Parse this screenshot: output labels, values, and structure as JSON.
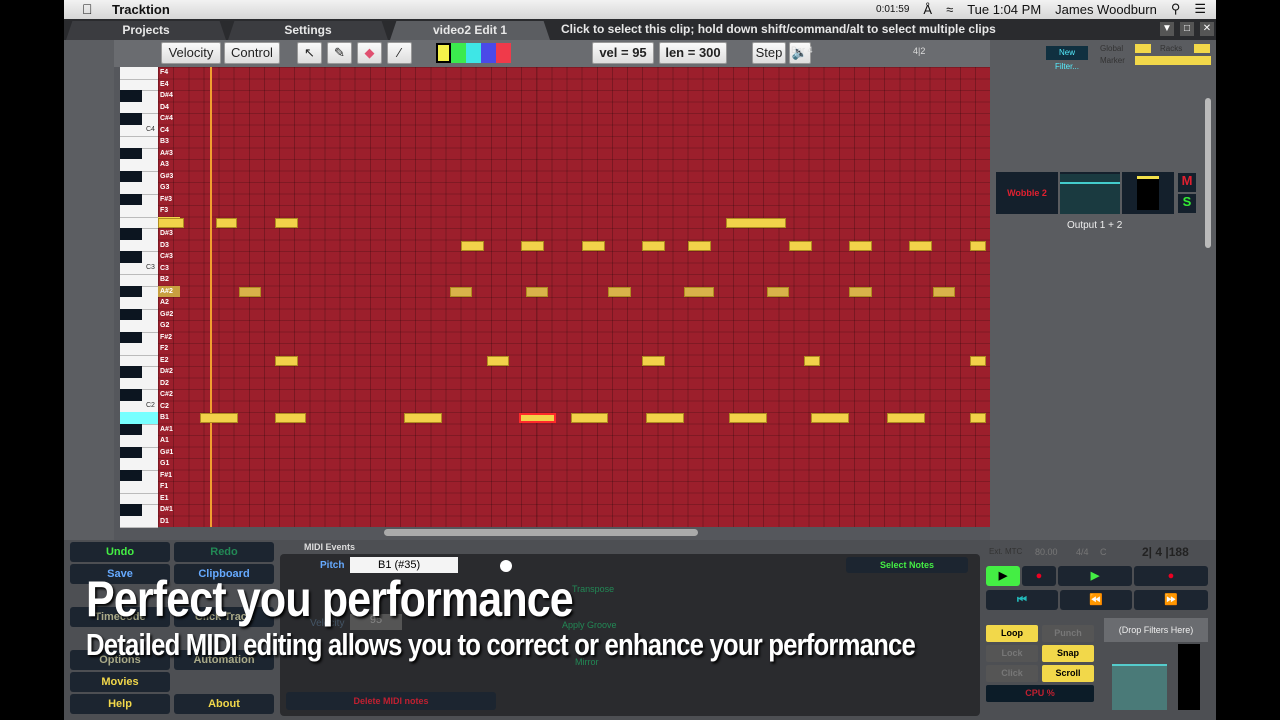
{
  "menubar": {
    "app_name": "Tracktion",
    "timer": "0:01:59",
    "clock": "Tue 1:04 PM",
    "user": "James Woodburn"
  },
  "tabs": [
    {
      "label": "Projects"
    },
    {
      "label": "Settings"
    },
    {
      "label": "video2 Edit 1"
    }
  ],
  "hint": "Click to select this clip; hold down shift/command/alt to select multiple clips",
  "toolbar": {
    "velocity": "Velocity",
    "control": "Control",
    "vel": "vel = 95",
    "len": "len = 300",
    "step": "Step",
    "colors": [
      "#f5f24a",
      "#3bea4e",
      "#3ee6e6",
      "#4a4ae8",
      "#f03a4a"
    ]
  },
  "ruler": {
    "bar": "Bar 4",
    "beat": "4|2"
  },
  "topright": {
    "new_filter": "New Filter...",
    "global": "Global",
    "marker": "Marker",
    "racks": "Racks"
  },
  "keys": [
    "F4",
    "E4",
    "D#4",
    "D4",
    "C#4",
    "C4",
    "B3",
    "A#3",
    "A3",
    "G#3",
    "G3",
    "F#3",
    "F3",
    "E3",
    "D#3",
    "D3",
    "C#3",
    "C3",
    "B2",
    "A#2",
    "A2",
    "G#2",
    "G2",
    "F#2",
    "F2",
    "E2",
    "D#2",
    "D2",
    "C#2",
    "C2",
    "B1",
    "A#1",
    "A1",
    "G#1",
    "G1",
    "F#1",
    "F1",
    "E1",
    "D#1",
    "D1"
  ],
  "octave_labels": {
    "C4": "C4",
    "C3": "C3",
    "C2": "C2"
  },
  "notes": [
    {
      "pitch": "E3",
      "start": 0,
      "len": 3.5
    },
    {
      "pitch": "E3",
      "start": 7.6,
      "len": 2.9
    },
    {
      "pitch": "E3",
      "start": 15.5,
      "len": 3
    },
    {
      "pitch": "E3",
      "start": 75,
      "len": 8
    },
    {
      "pitch": "D3",
      "start": 40,
      "len": 3
    },
    {
      "pitch": "D3",
      "start": 48,
      "len": 3
    },
    {
      "pitch": "D3",
      "start": 56,
      "len": 3
    },
    {
      "pitch": "D3",
      "start": 64,
      "len": 3
    },
    {
      "pitch": "D3",
      "start": 70,
      "len": 3
    },
    {
      "pitch": "D3",
      "start": 83.4,
      "len": 3
    },
    {
      "pitch": "D3",
      "start": 91.3,
      "len": 3
    },
    {
      "pitch": "D3",
      "start": 99.2,
      "len": 3
    },
    {
      "pitch": "D3",
      "start": 107.2,
      "len": 2.2
    },
    {
      "pitch": "A#2",
      "start": 10.7,
      "len": 2.9,
      "dim": true
    },
    {
      "pitch": "A#2",
      "start": 38.6,
      "len": 2.9,
      "dim": true
    },
    {
      "pitch": "A#2",
      "start": 48.6,
      "len": 2.9,
      "dim": true
    },
    {
      "pitch": "A#2",
      "start": 59.5,
      "len": 3,
      "dim": true
    },
    {
      "pitch": "A#2",
      "start": 69.5,
      "len": 4,
      "dim": true
    },
    {
      "pitch": "A#2",
      "start": 80.4,
      "len": 3,
      "dim": true
    },
    {
      "pitch": "A#2",
      "start": 91.3,
      "len": 3,
      "dim": true
    },
    {
      "pitch": "A#2",
      "start": 102.4,
      "len": 2.9,
      "dim": true
    },
    {
      "pitch": "E2",
      "start": 15.5,
      "len": 3
    },
    {
      "pitch": "E2",
      "start": 43.5,
      "len": 2.9
    },
    {
      "pitch": "E2",
      "start": 64,
      "len": 3
    },
    {
      "pitch": "E2",
      "start": 85.4,
      "len": 2
    },
    {
      "pitch": "E2",
      "start": 107.2,
      "len": 2.2
    },
    {
      "pitch": "B1",
      "start": 5.6,
      "len": 5
    },
    {
      "pitch": "B1",
      "start": 15.5,
      "len": 4
    },
    {
      "pitch": "B1",
      "start": 32.5,
      "len": 5
    },
    {
      "pitch": "B1",
      "start": 47.7,
      "len": 4.9,
      "selected": true
    },
    {
      "pitch": "B1",
      "start": 54.5,
      "len": 5
    },
    {
      "pitch": "B1",
      "start": 64.5,
      "len": 5
    },
    {
      "pitch": "B1",
      "start": 75.4,
      "len": 5
    },
    {
      "pitch": "B1",
      "start": 86.3,
      "len": 5
    },
    {
      "pitch": "B1",
      "start": 96.3,
      "len": 5
    },
    {
      "pitch": "B1",
      "start": 107.2,
      "len": 2.2
    }
  ],
  "track": {
    "plugin": "Wobble 2",
    "mute": "M",
    "solo": "S",
    "output": "Output 1 + 2"
  },
  "leftbuttons": {
    "undo": "Undo",
    "redo": "Redo",
    "save": "Save",
    "clipboard": "Clipboard",
    "timecode": "Timecode",
    "click_track": "Click Track",
    "options": "Options",
    "automation": "Automation",
    "movies": "Movies",
    "help": "Help",
    "about": "About"
  },
  "midi_events": {
    "tab": "MIDI Events",
    "pitch_label": "Pitch",
    "pitch_value": "B1 (#35)",
    "velocity_label": "Velocity",
    "velocity_value": "95",
    "transpose": "Transpose",
    "apply_groove": "Apply Groove",
    "mirror": "Mirror",
    "delete": "Delete MIDI notes",
    "select_notes": "Select Notes"
  },
  "transport": {
    "ext_mtc": "Ext. MTC",
    "tempo": "80.00",
    "timesig": "4/4",
    "key": "C",
    "position": "2| 4 |188",
    "loop": "Loop",
    "punch": "Punch",
    "lock": "Lock",
    "snap": "Snap",
    "click": "Click",
    "scroll": "Scroll",
    "cpu": "CPU %",
    "drop_filters": "(Drop Filters Here)"
  },
  "overlay": {
    "title": "Perfect you performance",
    "subtitle": "Detailed MIDI editing allows you to correct or enhance your performance"
  }
}
